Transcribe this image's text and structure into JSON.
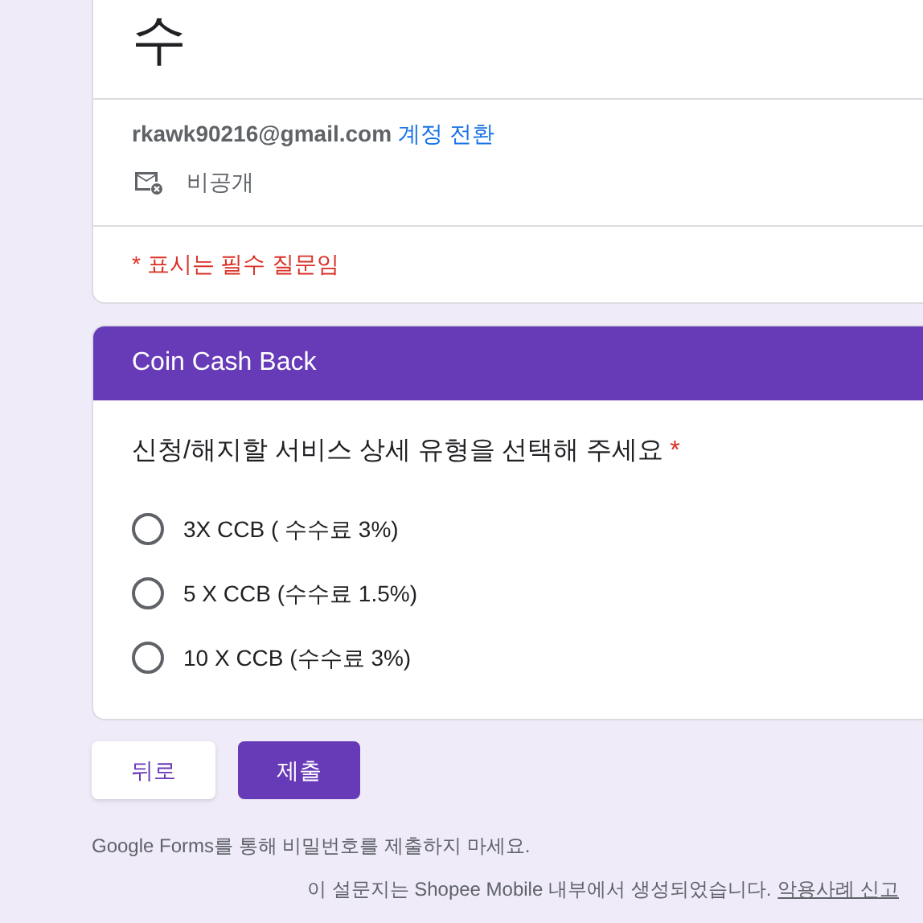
{
  "form_title": "수",
  "account": {
    "email": "rkawk90216@gmail.com",
    "switch_link": "계정 전환",
    "privacy": "비공개"
  },
  "required_note": "* 표시는 필수 질문임",
  "section": {
    "title": "Coin Cash Back",
    "question": "신청/해지할 서비스 상세 유형을 선택해 주세요",
    "required_mark": "*",
    "options": [
      {
        "label": "3X CCB ( 수수료 3%)",
        "selected": false
      },
      {
        "label": "5 X CCB (수수료 1.5%)",
        "selected": false
      },
      {
        "label": "10 X CCB (수수료 3%)",
        "selected": false
      }
    ]
  },
  "buttons": {
    "back": "뒤로",
    "submit": "제출"
  },
  "password_warning": "Google Forms를 통해 비밀번호를 제출하지 마세요.",
  "footer": {
    "text": "이 설문지는 Shopee Mobile 내부에서 생성되었습니다.",
    "report_link": "악용사례 신고"
  }
}
